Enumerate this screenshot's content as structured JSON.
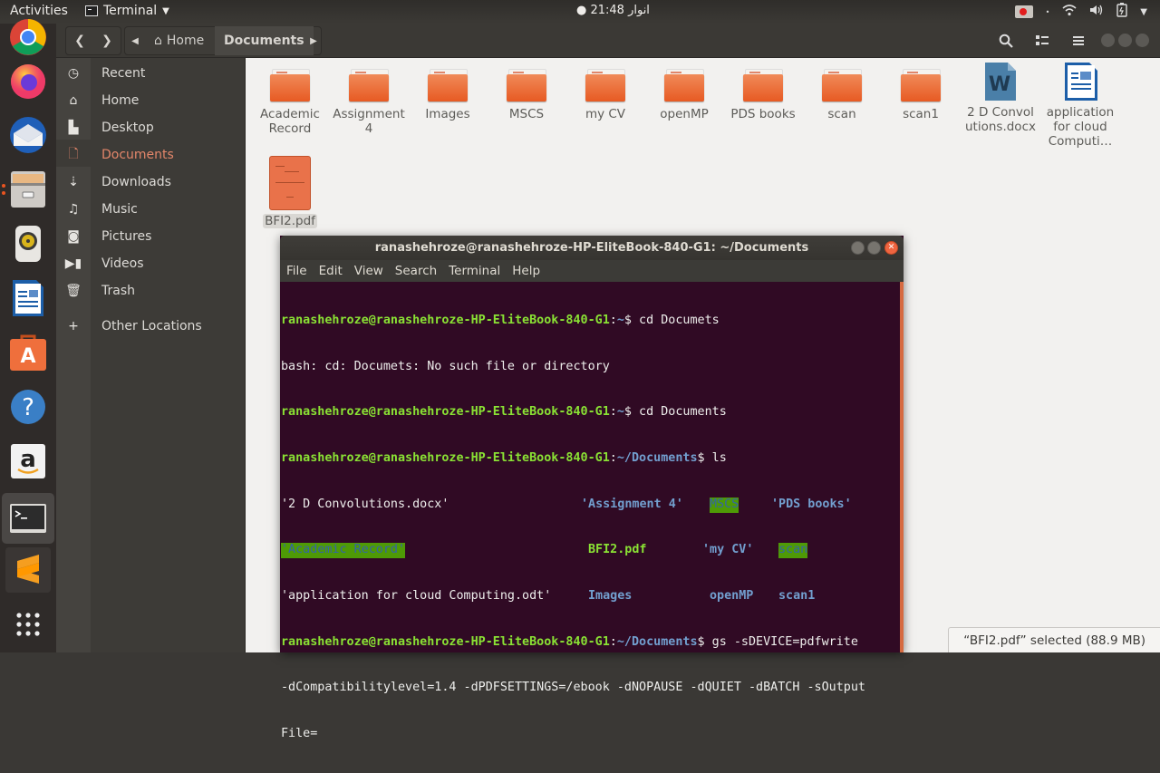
{
  "topbar": {
    "activities": "Activities",
    "app_name": "Terminal",
    "clock": "● انوار 21:48",
    "tray_icons": [
      "screen-recorder-icon",
      "dot-indicator",
      "wifi-icon",
      "volume-icon",
      "battery-icon",
      "system-menu-chevron"
    ]
  },
  "dock": {
    "items": [
      {
        "name": "chrome",
        "label": "Google Chrome"
      },
      {
        "name": "firefox",
        "label": "Firefox"
      },
      {
        "name": "thunderbird",
        "label": "Thunderbird"
      },
      {
        "name": "files",
        "label": "Files"
      },
      {
        "name": "rhythmbox",
        "label": "Rhythmbox"
      },
      {
        "name": "libreoffice-writer",
        "label": "LibreOffice Writer"
      },
      {
        "name": "software",
        "label": "Ubuntu Software"
      },
      {
        "name": "help",
        "label": "Help"
      },
      {
        "name": "amazon",
        "label": "Amazon"
      },
      {
        "name": "terminal",
        "label": "Terminal"
      },
      {
        "name": "sublime",
        "label": "Sublime Text"
      },
      {
        "name": "show-apps",
        "label": "Show Applications"
      }
    ]
  },
  "nautilus": {
    "breadcrumb": {
      "home": "Home",
      "current": "Documents"
    },
    "sidebar": [
      {
        "icon": "recent",
        "label": "Recent"
      },
      {
        "icon": "home",
        "label": "Home"
      },
      {
        "icon": "desktop",
        "label": "Desktop"
      },
      {
        "icon": "documents",
        "label": "Documents",
        "active": true
      },
      {
        "icon": "downloads",
        "label": "Downloads"
      },
      {
        "icon": "music",
        "label": "Music"
      },
      {
        "icon": "pictures",
        "label": "Pictures"
      },
      {
        "icon": "videos",
        "label": "Videos"
      },
      {
        "icon": "trash",
        "label": "Trash"
      },
      {
        "icon": "plus",
        "label": "Other Locations"
      }
    ],
    "files": [
      {
        "type": "folder",
        "name": "Academic Record"
      },
      {
        "type": "folder",
        "name": "Assignment 4"
      },
      {
        "type": "folder",
        "name": "Images"
      },
      {
        "type": "folder",
        "name": "MSCS"
      },
      {
        "type": "folder",
        "name": "my CV"
      },
      {
        "type": "folder",
        "name": "openMP"
      },
      {
        "type": "folder",
        "name": "PDS books"
      },
      {
        "type": "folder",
        "name": "scan"
      },
      {
        "type": "folder",
        "name": "scan1"
      },
      {
        "type": "docx",
        "name": "2 D Convolutions.docx"
      },
      {
        "type": "odt",
        "name": "application for cloud Computi…"
      },
      {
        "type": "pdf",
        "name": "BFI2.pdf",
        "selected": true
      }
    ],
    "status": "“BFI2.pdf” selected  (88.9 MB)"
  },
  "terminal": {
    "title": "ranashehroze@ranashehroze-HP-EliteBook-840-G1: ~/Documents",
    "menu": [
      "File",
      "Edit",
      "View",
      "Search",
      "Terminal",
      "Help"
    ],
    "prompt_user": "ranashehroze@ranashehroze-HP-EliteBook-840-G1",
    "lines": {
      "l1_path": "~",
      "l1_cmd": "$ cd Documets",
      "l2": "bash: cd: Documets: No such file or directory",
      "l3_path": "~",
      "l3_cmd": "$ cd Documents",
      "l4_path": "~/Documents",
      "l4_cmd": "$ ls",
      "ls": [
        [
          "'2 D Convolutions.docx'",
          "'Assignment 4'",
          "MSCS",
          "'PDS books'"
        ],
        [
          "'Academic Record'",
          "BFI2.pdf",
          "'my CV'",
          "scan"
        ],
        [
          "'application for cloud Computing.odt'",
          "Images",
          "openMP",
          "scan1"
        ]
      ],
      "l8_path": "~/Documents",
      "l8_cmd": "$ gs -sDEVICE=pdfwrite",
      "l9": "-dCompatibilitylevel=1.4 -dPDFSETTINGS=/ebook -dNOPAUSE -dQUIET -dBATCH -sOutput",
      "l10": "File="
    }
  }
}
